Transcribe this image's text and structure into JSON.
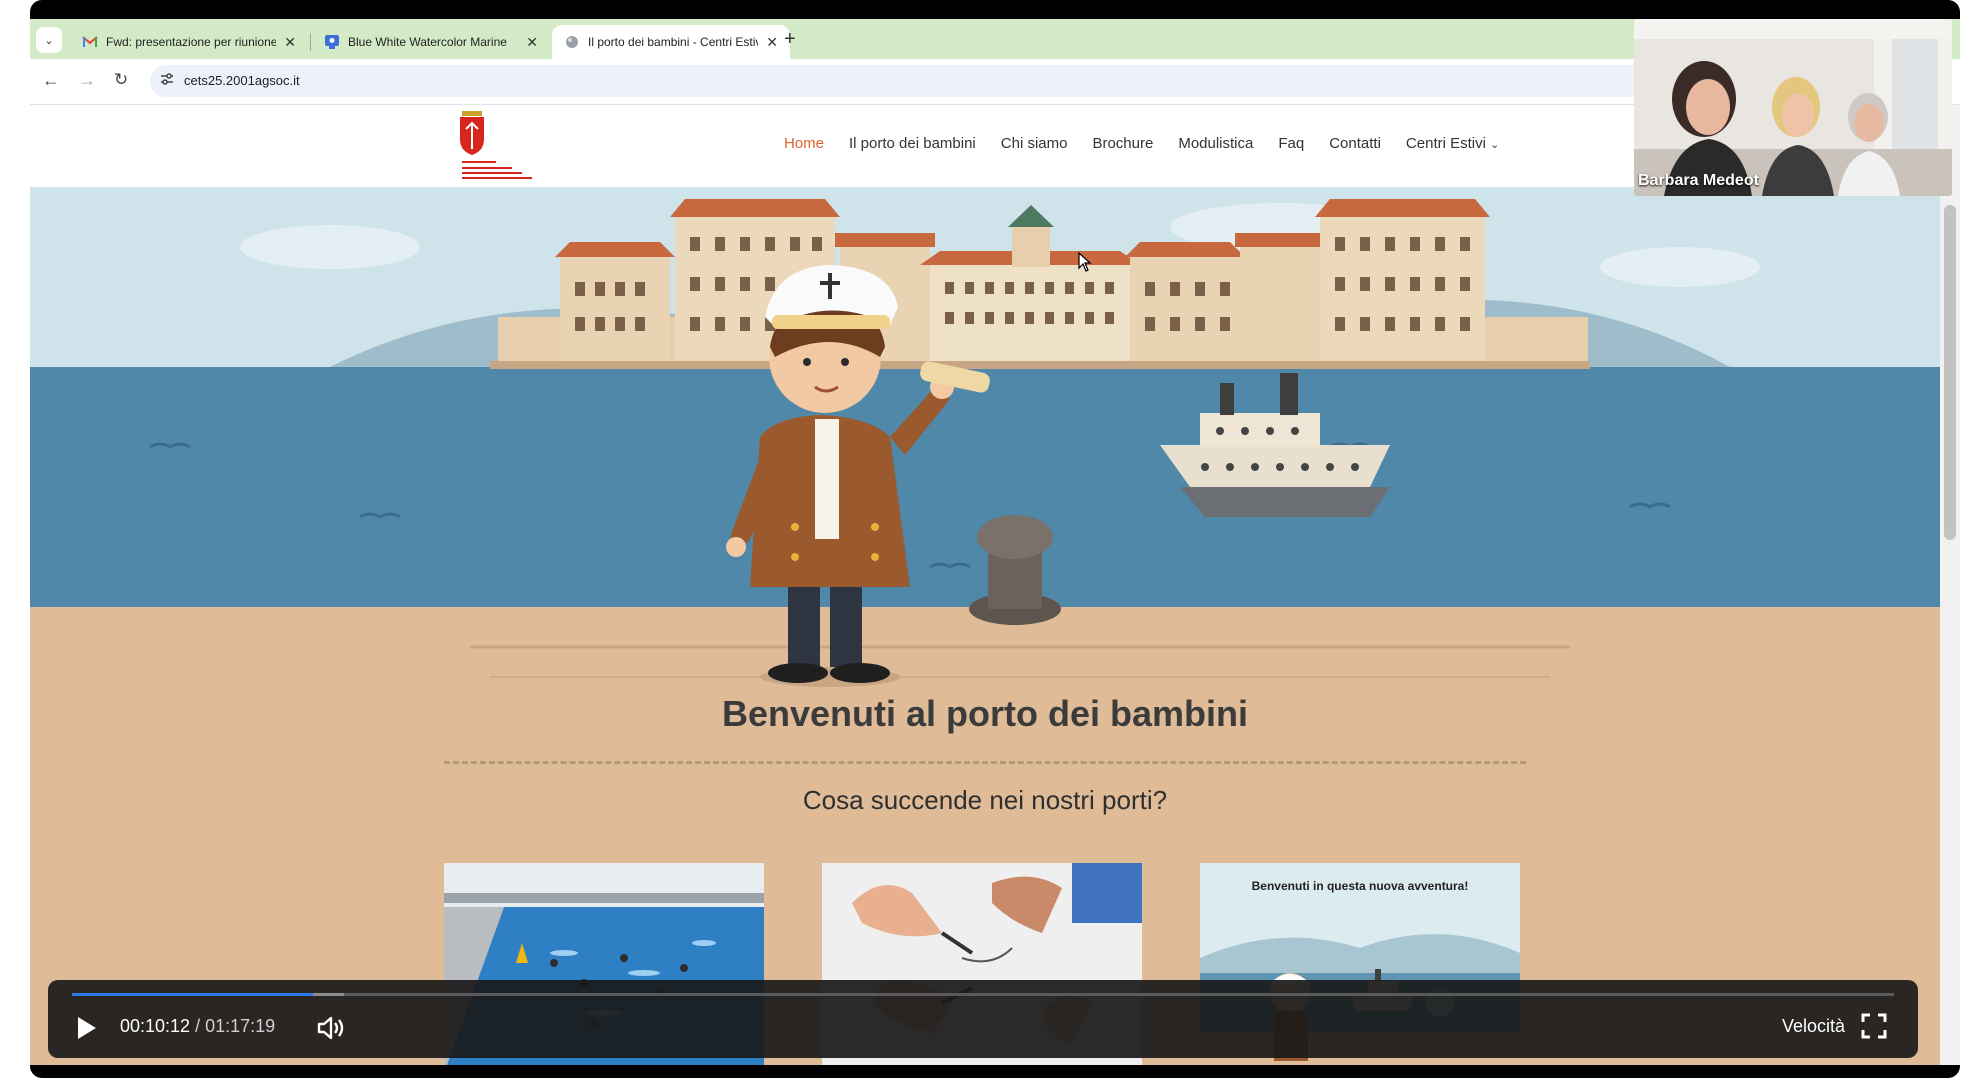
{
  "browser": {
    "tabs": [
      {
        "title": "Fwd: presentazione per riunione",
        "favicon": "gmail-icon",
        "active": false
      },
      {
        "title": "Blue White Watercolor Marine",
        "favicon": "canva-icon",
        "active": false
      },
      {
        "title": "Il porto dei bambini - Centri Estivi",
        "favicon": "globe-icon",
        "active": true
      }
    ],
    "url": "cets25.2001agsoc.it"
  },
  "site": {
    "nav": [
      "Home",
      "Il porto dei bambini",
      "Chi siamo",
      "Brochure",
      "Modulistica",
      "Faq",
      "Contatti",
      "Centri Estivi"
    ],
    "active_nav": "Home",
    "welcome": "Benvenuti al porto dei bambini",
    "question": "Cosa succende nei nostri porti?",
    "card3_title": "Benvenuti in questa nuova avventura!"
  },
  "video_call": {
    "participant_name": "Barbara Medeot"
  },
  "player": {
    "current_time": "00:10:12",
    "separator": "/",
    "total_time": "01:17:19",
    "speed_label": "Velocità",
    "progress_fraction": 0.132
  },
  "colors": {
    "tab_strip": "#d3eac6",
    "nav_active": "#e2622a",
    "page_bg": "#dfbc97",
    "progress": "#2f7bea"
  }
}
